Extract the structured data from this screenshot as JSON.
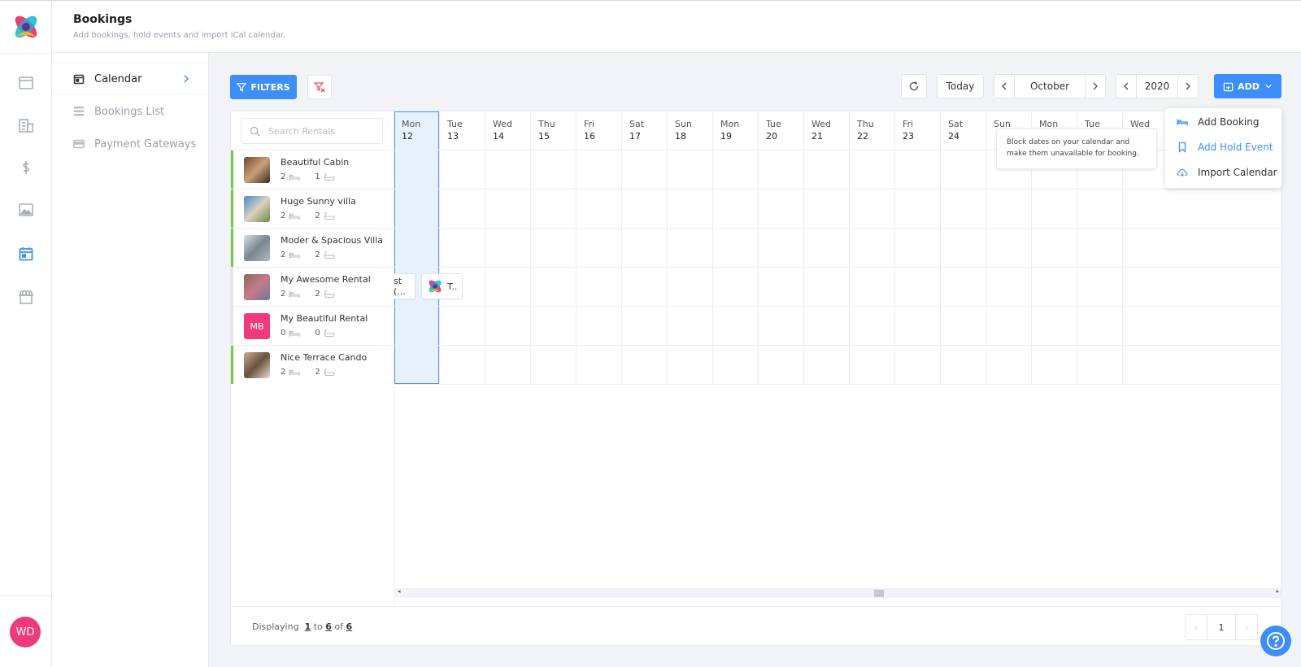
{
  "header": {
    "title": "Bookings",
    "subtitle": "Add bookings, hold events and import iCal calendar."
  },
  "rail": {
    "icons": [
      "window-icon",
      "building-icon",
      "dollar-icon",
      "image-icon",
      "calendar-icon",
      "store-icon"
    ],
    "active": "calendar-icon",
    "user_initials": "WD"
  },
  "subnav": {
    "items": [
      {
        "label": "Calendar",
        "icon": "calendar-icon",
        "active": true
      },
      {
        "label": "Bookings List",
        "icon": "list-icon",
        "active": false
      },
      {
        "label": "Payment Gateways",
        "icon": "card-icon",
        "active": false
      }
    ]
  },
  "toolbar": {
    "filters_label": "FILTERS",
    "today_label": "Today",
    "month": "October",
    "year": "2020",
    "add_label": "ADD"
  },
  "search": {
    "placeholder": "Search Rentals"
  },
  "days": [
    {
      "name": "Mon",
      "num": "12"
    },
    {
      "name": "Tue",
      "num": "13"
    },
    {
      "name": "Wed",
      "num": "14"
    },
    {
      "name": "Thu",
      "num": "15"
    },
    {
      "name": "Fri",
      "num": "16"
    },
    {
      "name": "Sat",
      "num": "17"
    },
    {
      "name": "Sun",
      "num": "18"
    },
    {
      "name": "Mon",
      "num": "19"
    },
    {
      "name": "Tue",
      "num": "20"
    },
    {
      "name": "Wed",
      "num": "21"
    },
    {
      "name": "Thu",
      "num": "22"
    },
    {
      "name": "Fri",
      "num": "23"
    },
    {
      "name": "Sat",
      "num": "24"
    },
    {
      "name": "Sun",
      "num": ""
    },
    {
      "name": "Mon",
      "num": ""
    },
    {
      "name": "Tue",
      "num": ""
    },
    {
      "name": "Wed",
      "num": ""
    }
  ],
  "rentals": [
    {
      "name": "Beautiful Cabin",
      "beds": "2",
      "baths": "1",
      "status_color": "#7ac943",
      "thumb": "photo"
    },
    {
      "name": "Huge Sunny villa",
      "beds": "2",
      "baths": "2",
      "status_color": "#7ac943",
      "thumb": "photo"
    },
    {
      "name": "Moder & Spacious Villa",
      "beds": "2",
      "baths": "2",
      "status_color": "#7ac943",
      "thumb": "photo"
    },
    {
      "name": "My Awesome Rental",
      "beds": "2",
      "baths": "2",
      "status_color": "#e6e6e6",
      "thumb": "photo"
    },
    {
      "name": "My Beautiful Rental",
      "beds": "0",
      "baths": "0",
      "status_color": "#e6e6e6",
      "thumb": "MB"
    },
    {
      "name": "Nice Terrace Cando",
      "beds": "2",
      "baths": "2",
      "status_color": "#7ac943",
      "thumb": "photo"
    }
  ],
  "bookings": [
    {
      "label": "st (...",
      "row": 3
    },
    {
      "label": "T..",
      "row": 3
    }
  ],
  "dropdown": {
    "items": [
      {
        "label": "Add Booking",
        "icon": "bed-icon"
      },
      {
        "label": "Add Hold Event",
        "icon": "bookmark-icon"
      },
      {
        "label": "Import Calendar",
        "icon": "cloud-download-icon"
      }
    ],
    "tooltip": "Block dates on your calendar and make them unavailable for booking."
  },
  "footer": {
    "prefix": "Displaying",
    "from": "1",
    "to_word": "to",
    "to": "6",
    "of_word": "of",
    "total": "6",
    "page": "1"
  },
  "colors": {
    "accent": "#3d8ef8",
    "brand_pink": "#ef3b7b",
    "status_green": "#7ac943"
  }
}
